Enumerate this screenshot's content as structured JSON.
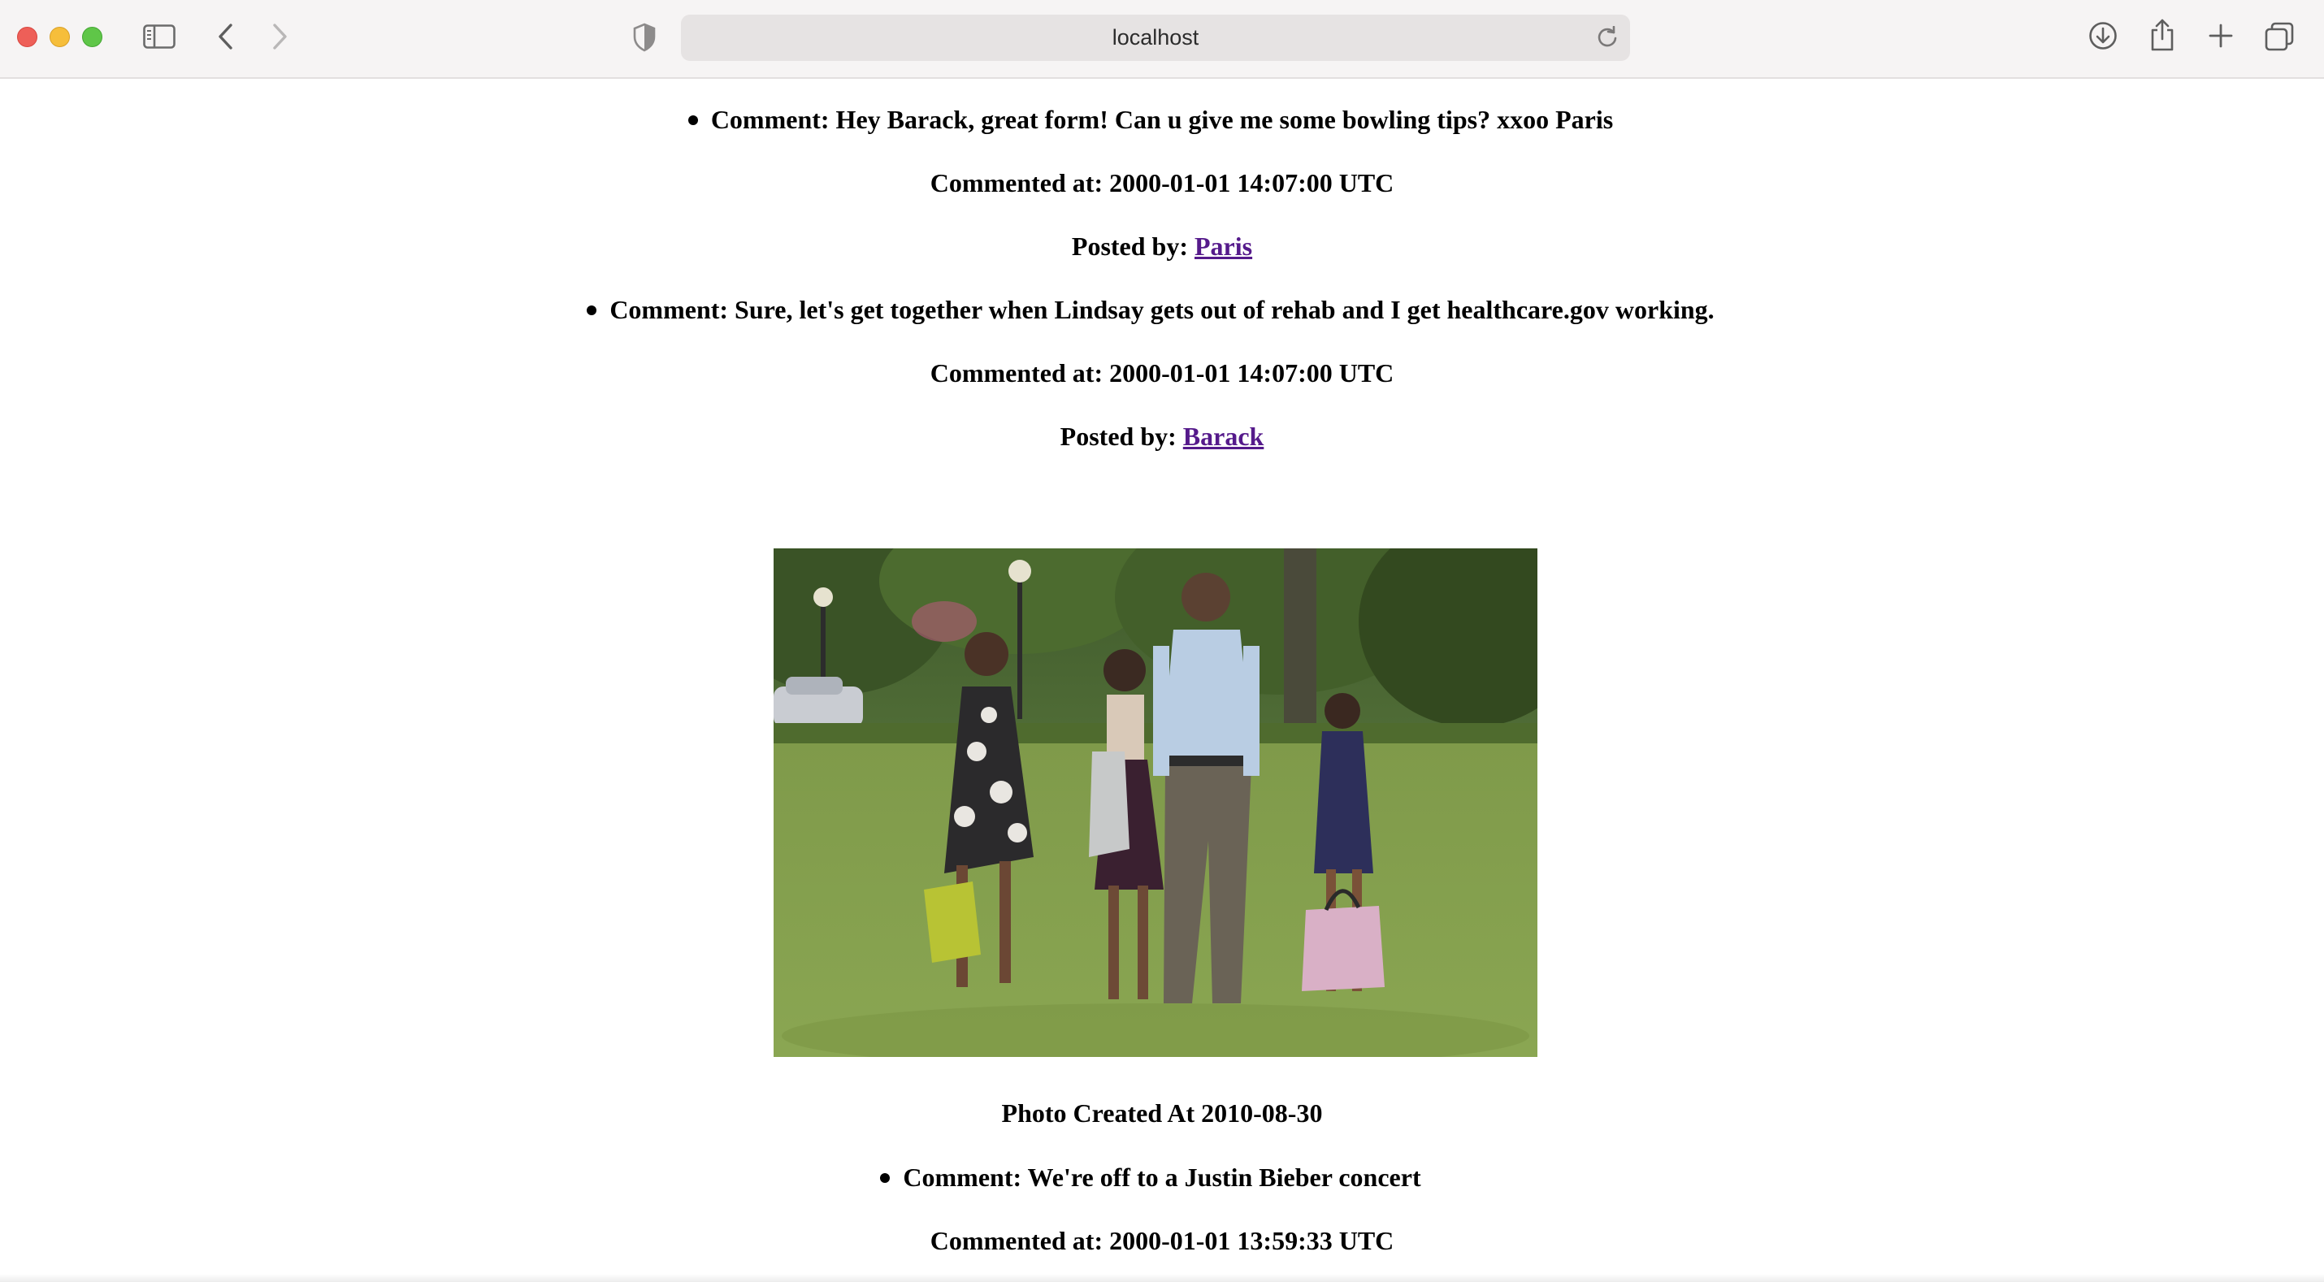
{
  "browser": {
    "url": "localhost",
    "icons": {
      "sidebar": "sidebar-icon",
      "back": "chevron-left-icon",
      "forward": "chevron-right-icon",
      "privacy": "shield-icon",
      "reload": "reload-icon",
      "downloads": "download-icon",
      "share": "share-icon",
      "new_tab": "plus-icon",
      "tabs": "tab-overview-icon"
    }
  },
  "feed": {
    "comments_top": [
      {
        "label": "Comment:",
        "text": "Hey Barack, great form! Can u give me some bowling tips? xxoo Paris",
        "commented_at_label": "Commented at:",
        "commented_at": "2000-01-01 14:07:00 UTC",
        "posted_by_label": "Posted by:",
        "author": "Paris"
      },
      {
        "label": "Comment:",
        "text": "Sure, let's get together when Lindsay gets out of rehab and I get healthcare.gov working.",
        "commented_at_label": "Commented at:",
        "commented_at": "2000-01-01 14:07:00 UTC",
        "posted_by_label": "Posted by:",
        "author": "Barack"
      }
    ],
    "photo": {
      "created_label": "Photo Created At",
      "created_at": "2010-08-30"
    },
    "comments_bottom": [
      {
        "label": "Comment:",
        "text": "We're off to a Justin Bieber concert",
        "commented_at_label": "Commented at:",
        "commented_at": "2000-01-01 13:59:33 UTC"
      }
    ]
  },
  "colors": {
    "link": "#551a8b",
    "chrome_bg": "#f6f4f4",
    "close": "#ee5f58",
    "minimize": "#f6be3b",
    "maximize": "#5fc648"
  }
}
